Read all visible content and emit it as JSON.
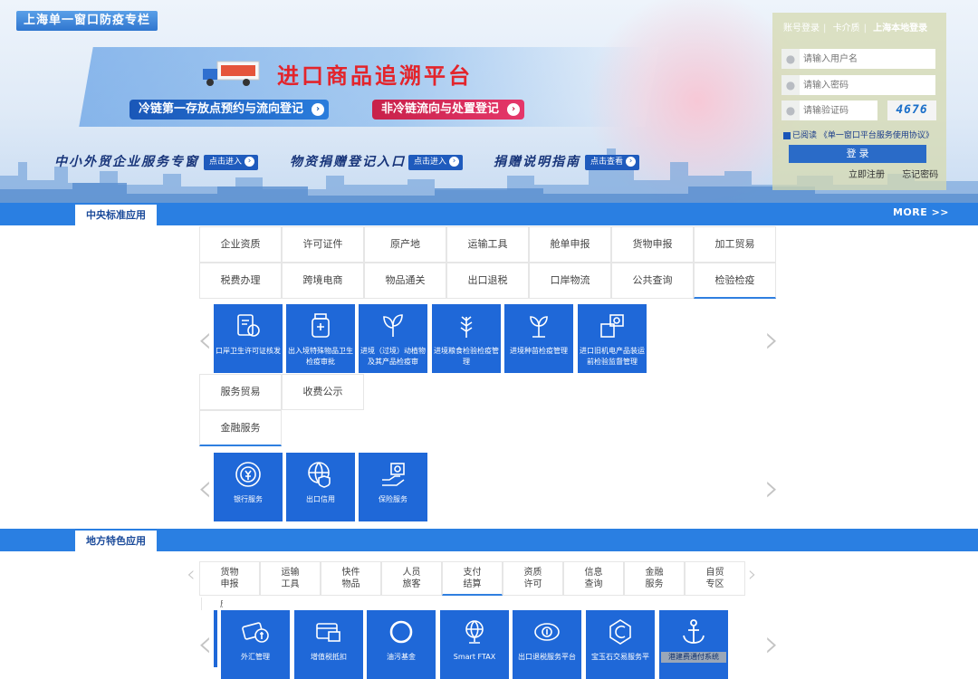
{
  "banner": {
    "zone_tag": "上海单一窗口防疫专栏",
    "main_title": "进口商品追溯平台",
    "pill_blue": "冷链第一存放点预约与流向登记",
    "pill_red": "非冷链流向与处置登记",
    "entries": [
      {
        "label": "中小外贸企业服务专窗",
        "button": "点击进入"
      },
      {
        "label": "物资捐赠登记入口",
        "button": "点击进入"
      },
      {
        "label": "捐赠说明指南",
        "button": "点击查看"
      }
    ]
  },
  "login": {
    "tabs": [
      "账号登录",
      "卡介质",
      "上海本地登录"
    ],
    "username_placeholder": "请输入用户名",
    "password_placeholder": "请输入密码",
    "captcha_placeholder": "请输验证码",
    "captcha_text": "4676",
    "agree_text": "已阅读 《单一窗口平台服务使用协议》",
    "login_button": "登 录",
    "register": "立即注册",
    "forgot": "忘记密码"
  },
  "central": {
    "tab": "中央标准应用",
    "more": "MORE >>",
    "row1": [
      "企业资质",
      "许可证件",
      "原产地",
      "运输工具",
      "舱单申报",
      "货物申报",
      "加工贸易"
    ],
    "row2": [
      "税费办理",
      "跨境电商",
      "物品通关",
      "出口退税",
      "口岸物流",
      "公共查询",
      "检验检疫"
    ],
    "apps1": [
      "口岸卫生许可证核发",
      "出入境特殊物品卫生检疫审批",
      "进境（过境）动植物及其产品检疫审",
      "进境粮食检验检疫管理",
      "进境种苗检疫管理",
      "进口旧机电产品装运前检验监督管理"
    ],
    "row3": [
      "服务贸易",
      "收费公示"
    ],
    "row4": [
      "金融服务"
    ],
    "apps2": [
      "银行服务",
      "出口信用",
      "保险服务"
    ]
  },
  "local": {
    "tab": "地方特色应用",
    "tabs": [
      "货物\n申报",
      "运输\n工具",
      "快件\n物品",
      "人员\n旅客",
      "支付\n结算",
      "资质\n许可",
      "信息\n查询",
      "金融\n服务",
      "自贸\n专区"
    ],
    "hidden_label": "应用",
    "apps": [
      "外汇管理",
      "增值税抵扣",
      "油污基金",
      "Smart FTAX",
      "出口退税服务平台",
      "宝玉石交易服务平",
      "港建费通付系统"
    ]
  },
  "colors": {
    "primary": "#2a7fe2",
    "tile": "#1f68d8",
    "title_red": "#e3242b"
  }
}
